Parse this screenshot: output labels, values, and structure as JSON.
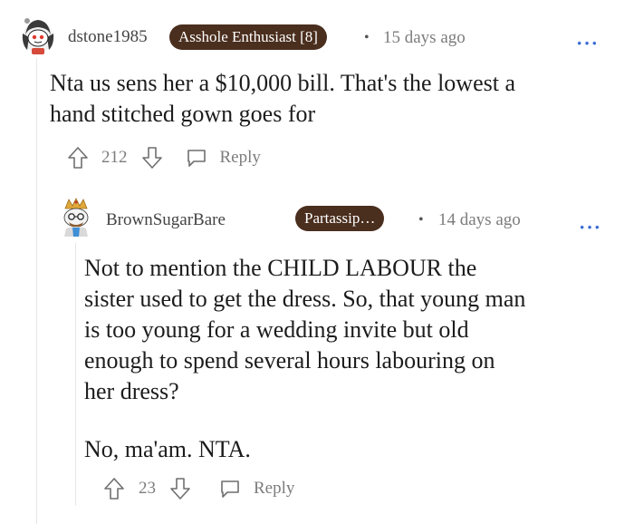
{
  "comment1": {
    "username": "dstone1985",
    "flair": "Asshole Enthusiast [8]",
    "separator": "•",
    "time": "15 days ago",
    "more": "···",
    "text_lines": [
      "Nta us sens her a $10,000 bill. That's the lowest a",
      "hand stitched gown goes for"
    ],
    "votes": "212",
    "reply_label": "Reply"
  },
  "comment2": {
    "username": "BrownSugarBare",
    "flair": "Partassip…",
    "separator": "•",
    "time": "14 days ago",
    "more": "···",
    "paragraph1_lines": [
      "Not to mention the CHILD LABOUR the",
      "sister used to get the dress. So, that young man",
      "is too young for a wedding invite but old",
      "enough to spend several hours labouring on",
      "her dress?"
    ],
    "paragraph2": "No, ma'am. NTA.",
    "votes": "23",
    "reply_label": "Reply"
  },
  "colors": {
    "flair_bg": "#4a2e1e",
    "more_blue": "#3b6ed6",
    "meta_gray": "#7c7c7c"
  },
  "icons": [
    "snoo-avatar-icon",
    "upvote-arrow-icon",
    "downvote-arrow-icon",
    "comment-bubble-icon",
    "more-options-icon"
  ]
}
